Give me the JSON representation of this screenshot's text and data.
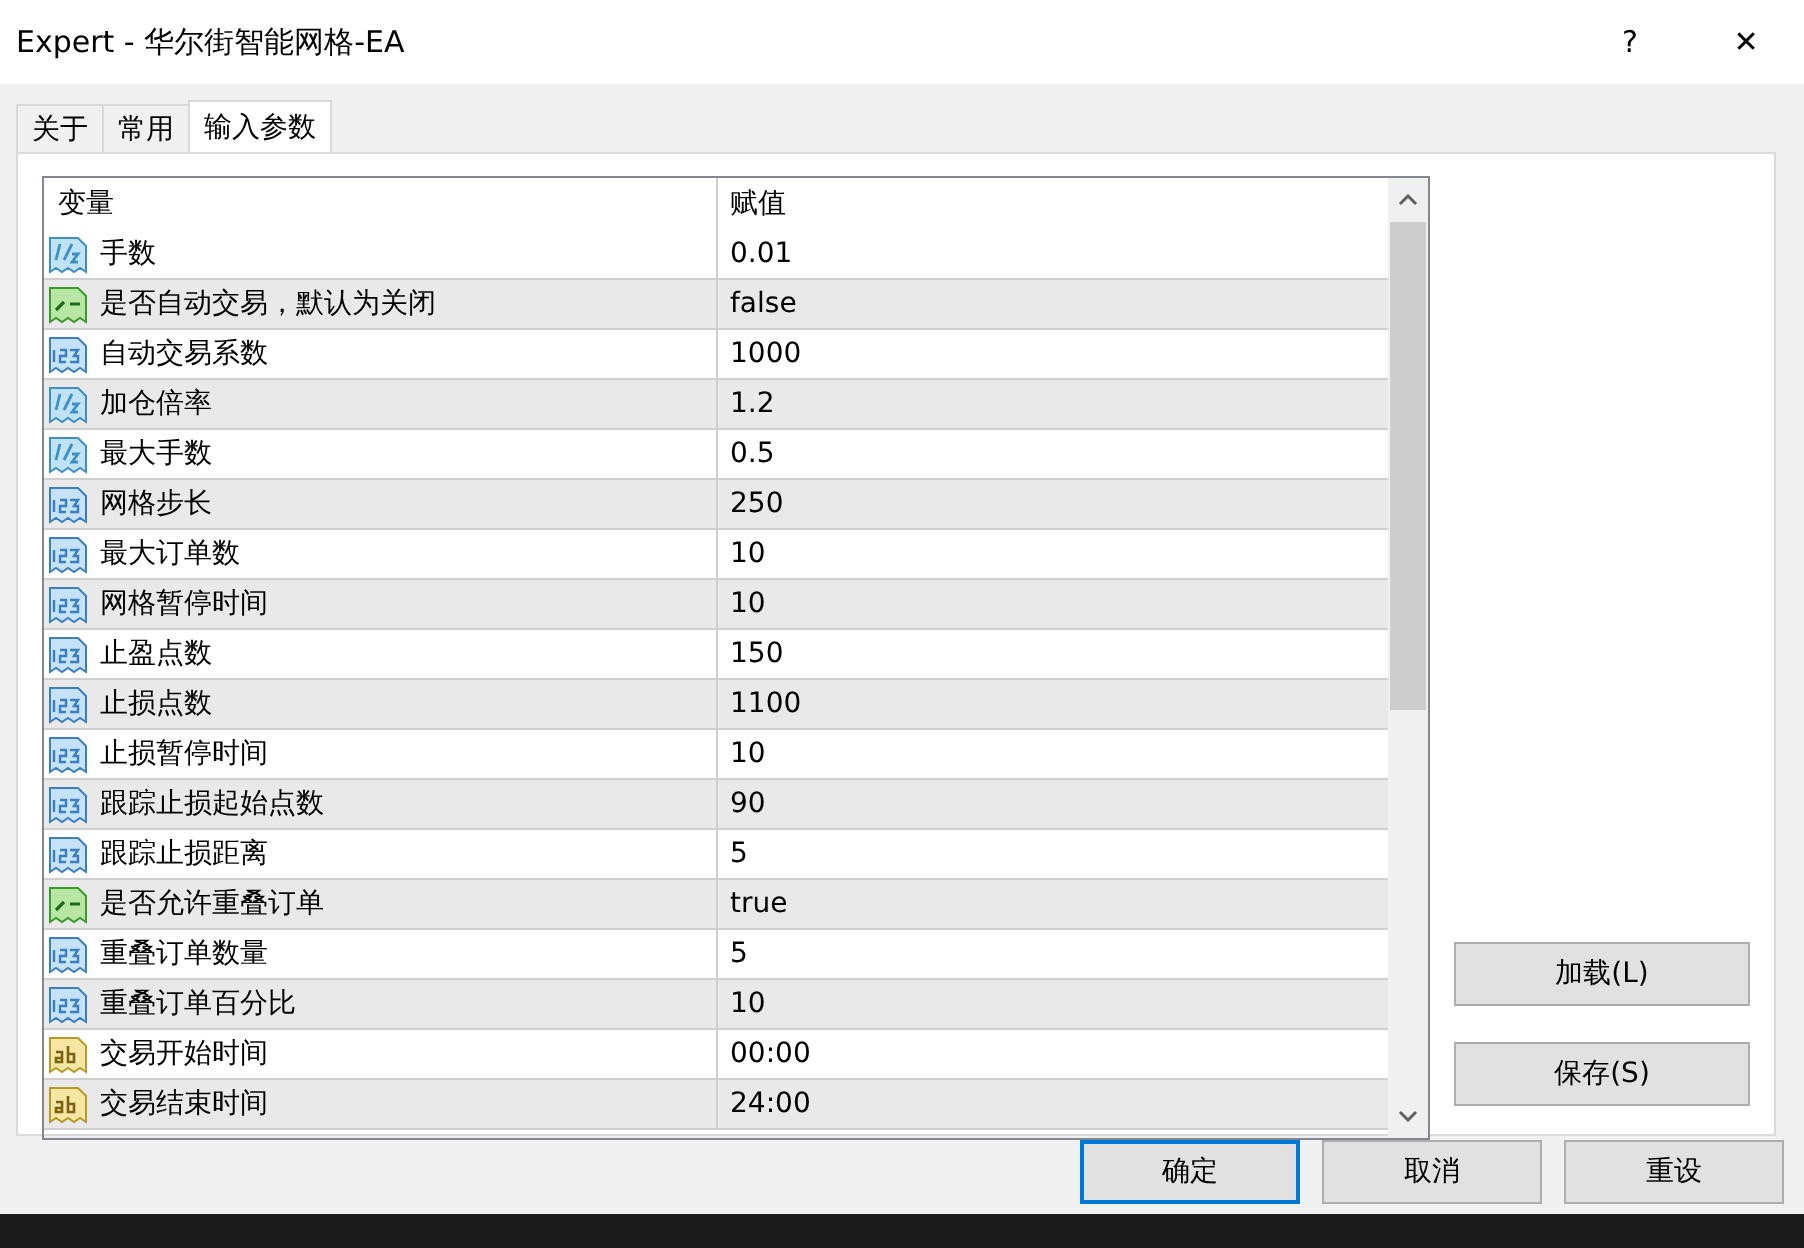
{
  "window": {
    "title": "Expert - 华尔街智能网格-EA",
    "help": "?",
    "close": "✕"
  },
  "tabs": [
    {
      "label": "关于",
      "selected": false
    },
    {
      "label": "常用",
      "selected": false
    },
    {
      "label": "输入参数",
      "selected": true
    }
  ],
  "table": {
    "columns": [
      "变量",
      "赋值"
    ],
    "rows": [
      {
        "kind": "double",
        "name": "手数",
        "value": "0.01"
      },
      {
        "kind": "bool",
        "name": "是否自动交易，默认为关闭",
        "value": "false"
      },
      {
        "kind": "int",
        "name": "自动交易系数",
        "value": "1000"
      },
      {
        "kind": "double",
        "name": "加仓倍率",
        "value": "1.2"
      },
      {
        "kind": "double",
        "name": "最大手数",
        "value": "0.5"
      },
      {
        "kind": "int",
        "name": "网格步长",
        "value": "250"
      },
      {
        "kind": "int",
        "name": "最大订单数",
        "value": "10"
      },
      {
        "kind": "int",
        "name": "网格暂停时间",
        "value": "10"
      },
      {
        "kind": "int",
        "name": "止盈点数",
        "value": "150"
      },
      {
        "kind": "int",
        "name": "止损点数",
        "value": "1100"
      },
      {
        "kind": "int",
        "name": "止损暂停时间",
        "value": "10"
      },
      {
        "kind": "int",
        "name": "跟踪止损起始点数",
        "value": "90"
      },
      {
        "kind": "int",
        "name": "跟踪止损距离",
        "value": "5"
      },
      {
        "kind": "bool",
        "name": "是否允许重叠订单",
        "value": "true"
      },
      {
        "kind": "int",
        "name": "重叠订单数量",
        "value": "5"
      },
      {
        "kind": "int",
        "name": "重叠订单百分比",
        "value": "10"
      },
      {
        "kind": "string",
        "name": "交易开始时间",
        "value": "00:00"
      },
      {
        "kind": "string",
        "name": "交易结束时间",
        "value": "24:00"
      }
    ]
  },
  "side_buttons": [
    "加载(L)",
    "保存(S)"
  ],
  "bottom_buttons": [
    {
      "label": "确定",
      "default": true
    },
    {
      "label": "取消",
      "default": false
    },
    {
      "label": "重设",
      "default": false
    }
  ]
}
